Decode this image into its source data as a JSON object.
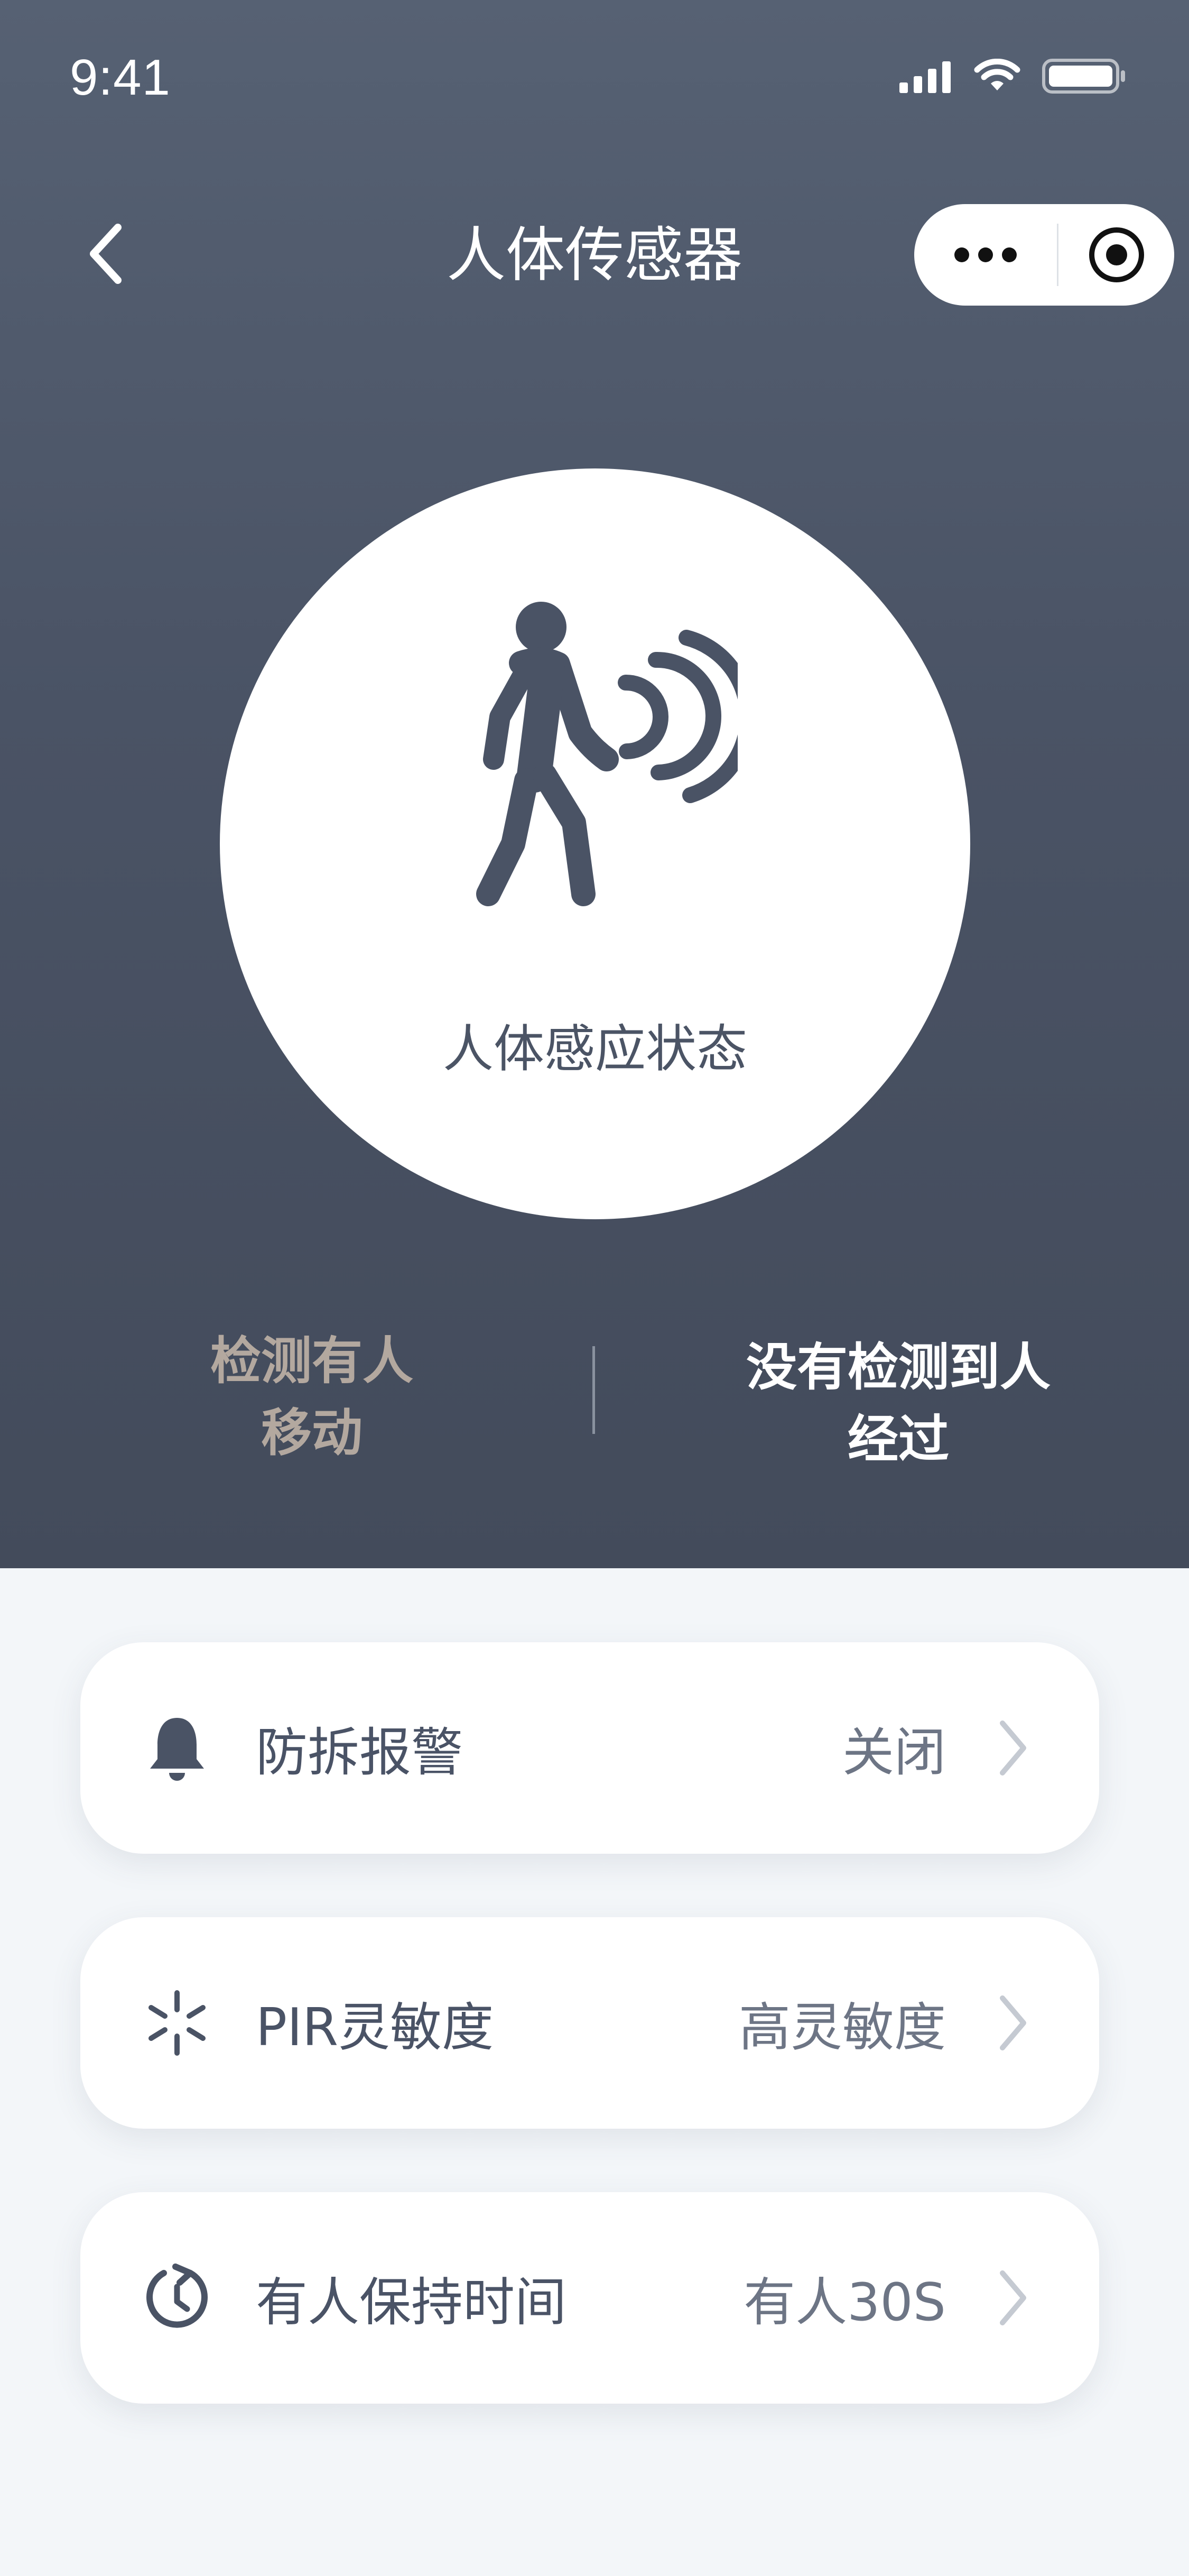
{
  "status_bar": {
    "time": "9:41"
  },
  "nav": {
    "title": "人体传感器"
  },
  "sensor": {
    "status_label": "人体感应状态"
  },
  "states": {
    "left": {
      "line1": "检测有人",
      "line2": "移动"
    },
    "right": {
      "line1": "没有检测到人",
      "line2": "经过"
    }
  },
  "settings": [
    {
      "label": "防拆报警",
      "value": "关闭",
      "icon": "bell-icon"
    },
    {
      "label": "PIR灵敏度",
      "value": "高灵敏度",
      "icon": "sensitivity-icon"
    },
    {
      "label": "有人保持时间",
      "value": "有人30S",
      "icon": "timer-icon"
    }
  ],
  "colors": {
    "header_bg": "#4a5365",
    "text_dark": "#4a5366",
    "inactive_state": "#b3a89f",
    "page_bg": "#f3f6f9"
  }
}
